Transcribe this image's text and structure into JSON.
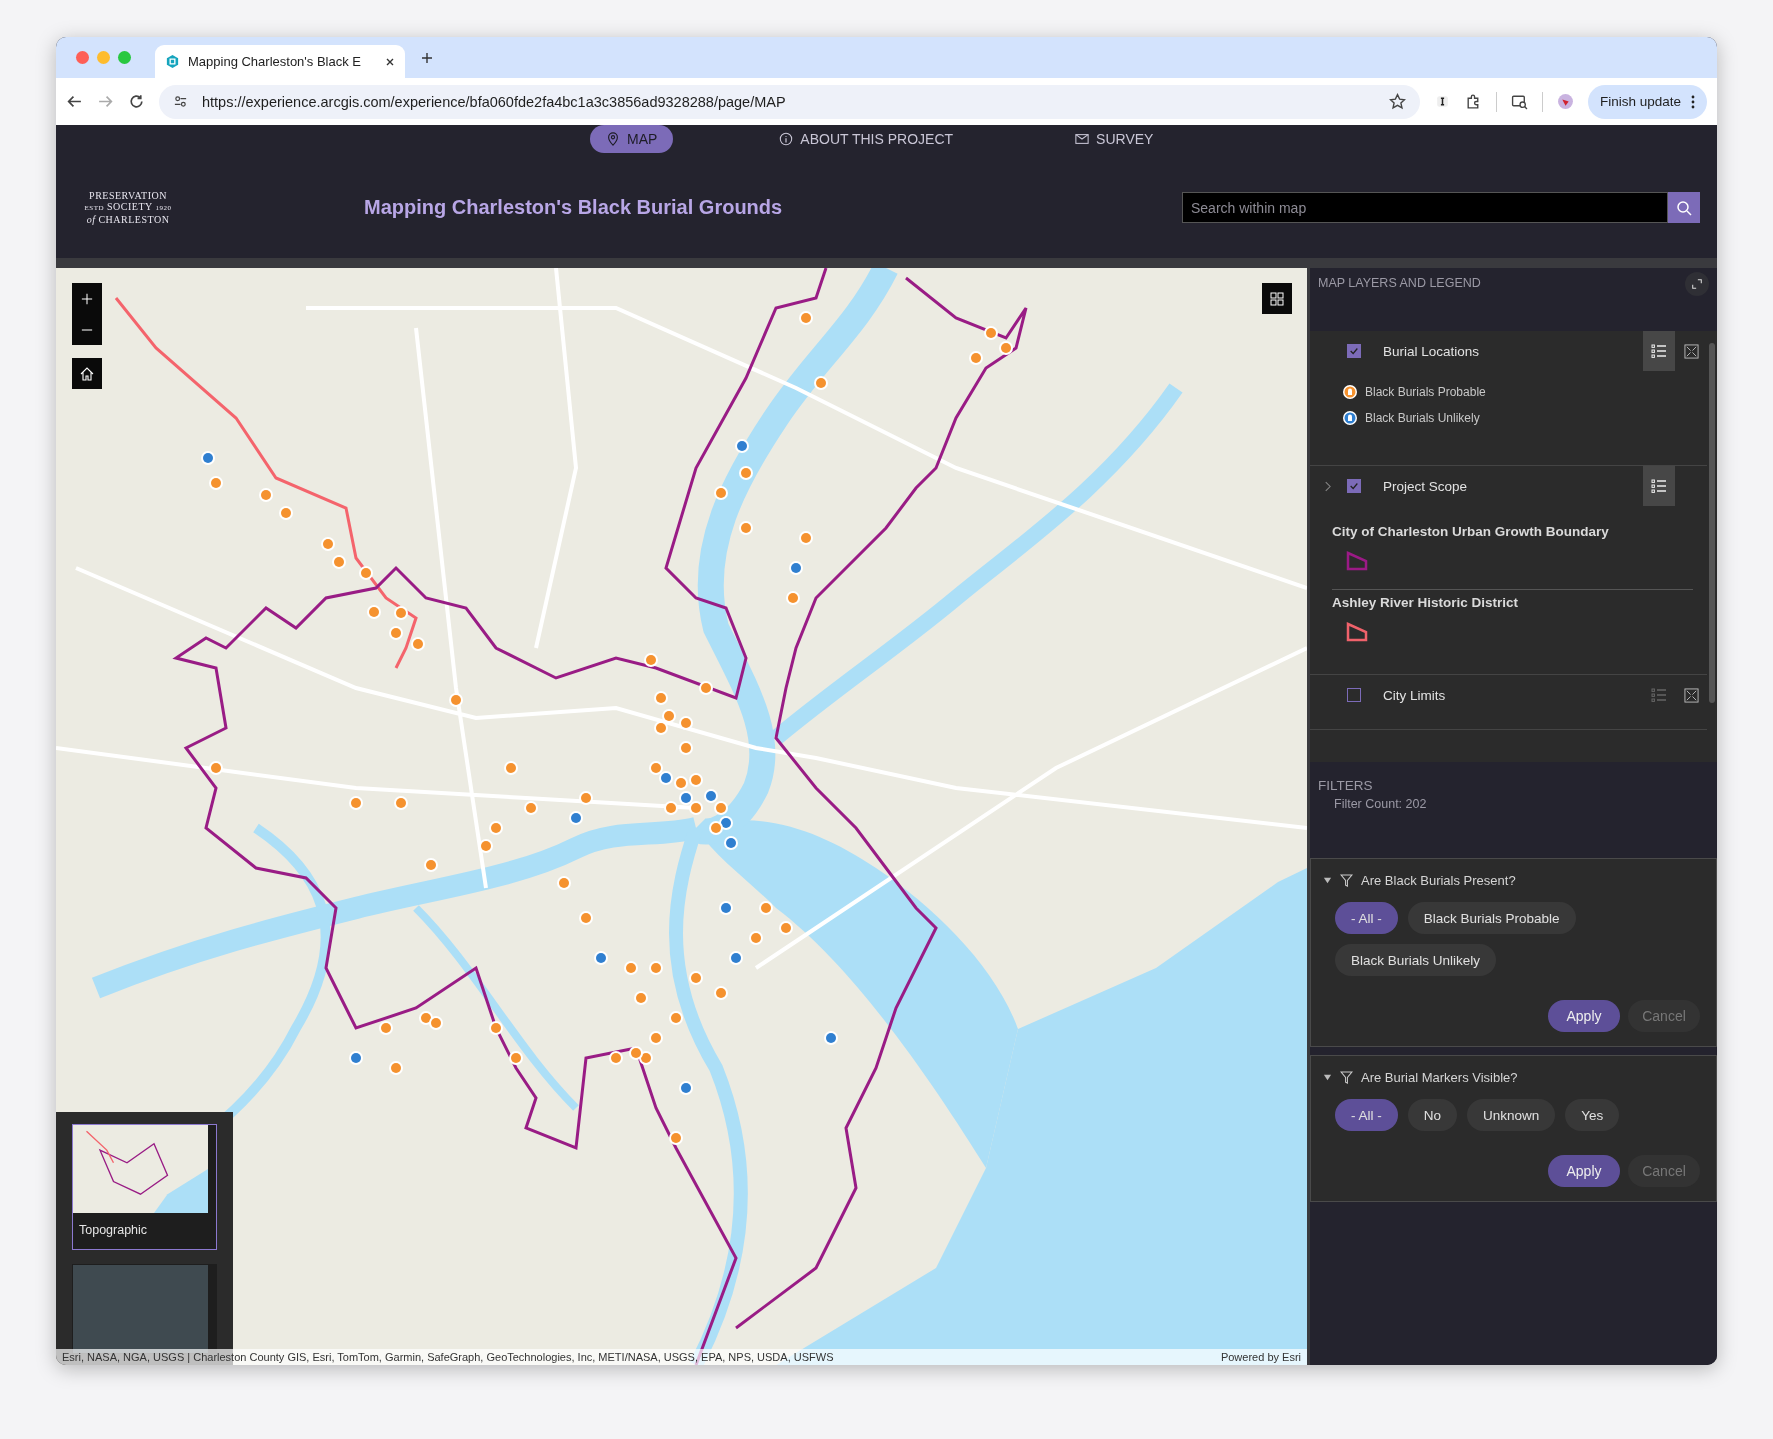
{
  "browser": {
    "tab_title": "Mapping Charleston's Black E",
    "url": "https://experience.arcgis.com/experience/bfa060fde2fa4bc1a3c3856ad9328288/page/MAP",
    "update_button": "Finish update"
  },
  "nav": [
    {
      "label": "MAP",
      "kind": "pin",
      "selected": true
    },
    {
      "label": "ABOUT THIS PROJECT",
      "kind": "info",
      "selected": false
    },
    {
      "label": "SURVEY",
      "kind": "mail",
      "selected": false
    }
  ],
  "logo": {
    "top": "PRESERVATION",
    "estd": "ESTD",
    "middle": "SOCIETY",
    "year": "1920",
    "bottom": "*of* CHARLESTON"
  },
  "title": "Mapping Charleston's Black Burial Grounds",
  "search": {
    "placeholder": "Search within map"
  },
  "map": {
    "basemaps": [
      {
        "label": "Topographic",
        "kind": "topo",
        "selected": true
      },
      {
        "kind": "imagery",
        "selected": false
      }
    ],
    "attribution": "Esri, NASA, NGA, USGS | Charleston County GIS, Esri, TomTom, Garmin, SafeGraph, GeoTechnologies, Inc, METI/NASA, USGS, EPA, NPS, USDA, USFWS",
    "powered_by": "Powered by Esri"
  },
  "layers_panel": {
    "heading": "MAP LAYERS AND LEGEND",
    "layers": [
      {
        "name": "Burial Locations",
        "checked": true,
        "expandable": false,
        "legend_active": true,
        "extent_button": true,
        "legend": [
          {
            "label": "Black Burials Probable",
            "color": "#f5922f"
          },
          {
            "label": "Black Burials Unlikely",
            "color": "#2f7fd0"
          }
        ]
      },
      {
        "name": "Project Scope",
        "checked": true,
        "expandable": true,
        "legend_active": true,
        "extent_button": false,
        "sublayers": [
          {
            "label": "City of Charleston Urban Growth Boundary",
            "color": "#9b1a86"
          },
          {
            "label": "Ashley River Historic District",
            "color": "#f0626b"
          }
        ]
      },
      {
        "name": "City Limits",
        "checked": false,
        "expandable": false,
        "legend_active": false,
        "extent_button": true
      }
    ]
  },
  "filters": {
    "heading": "FILTERS",
    "count": "Filter Count: 202",
    "groups": [
      {
        "title": "Are Black Burials Present?",
        "expanded": true,
        "options": [
          {
            "label": "- All -",
            "selected": true
          },
          {
            "label": "Black Burials Probable",
            "selected": false
          },
          {
            "label": "Black Burials Unlikely",
            "selected": false
          }
        ],
        "buttons": [
          {
            "label": "Apply",
            "disabled": false
          },
          {
            "label": "Cancel",
            "disabled": true
          }
        ]
      },
      {
        "title": "Are Burial Markers Visible?",
        "expanded": true,
        "options": [
          {
            "label": "- All -",
            "selected": true
          },
          {
            "label": "No",
            "selected": false
          },
          {
            "label": "Unknown",
            "selected": false
          },
          {
            "label": "Yes",
            "selected": false
          }
        ],
        "buttons": [
          {
            "label": "Apply",
            "disabled": false
          },
          {
            "label": "Cancel",
            "disabled": true
          }
        ]
      }
    ]
  }
}
